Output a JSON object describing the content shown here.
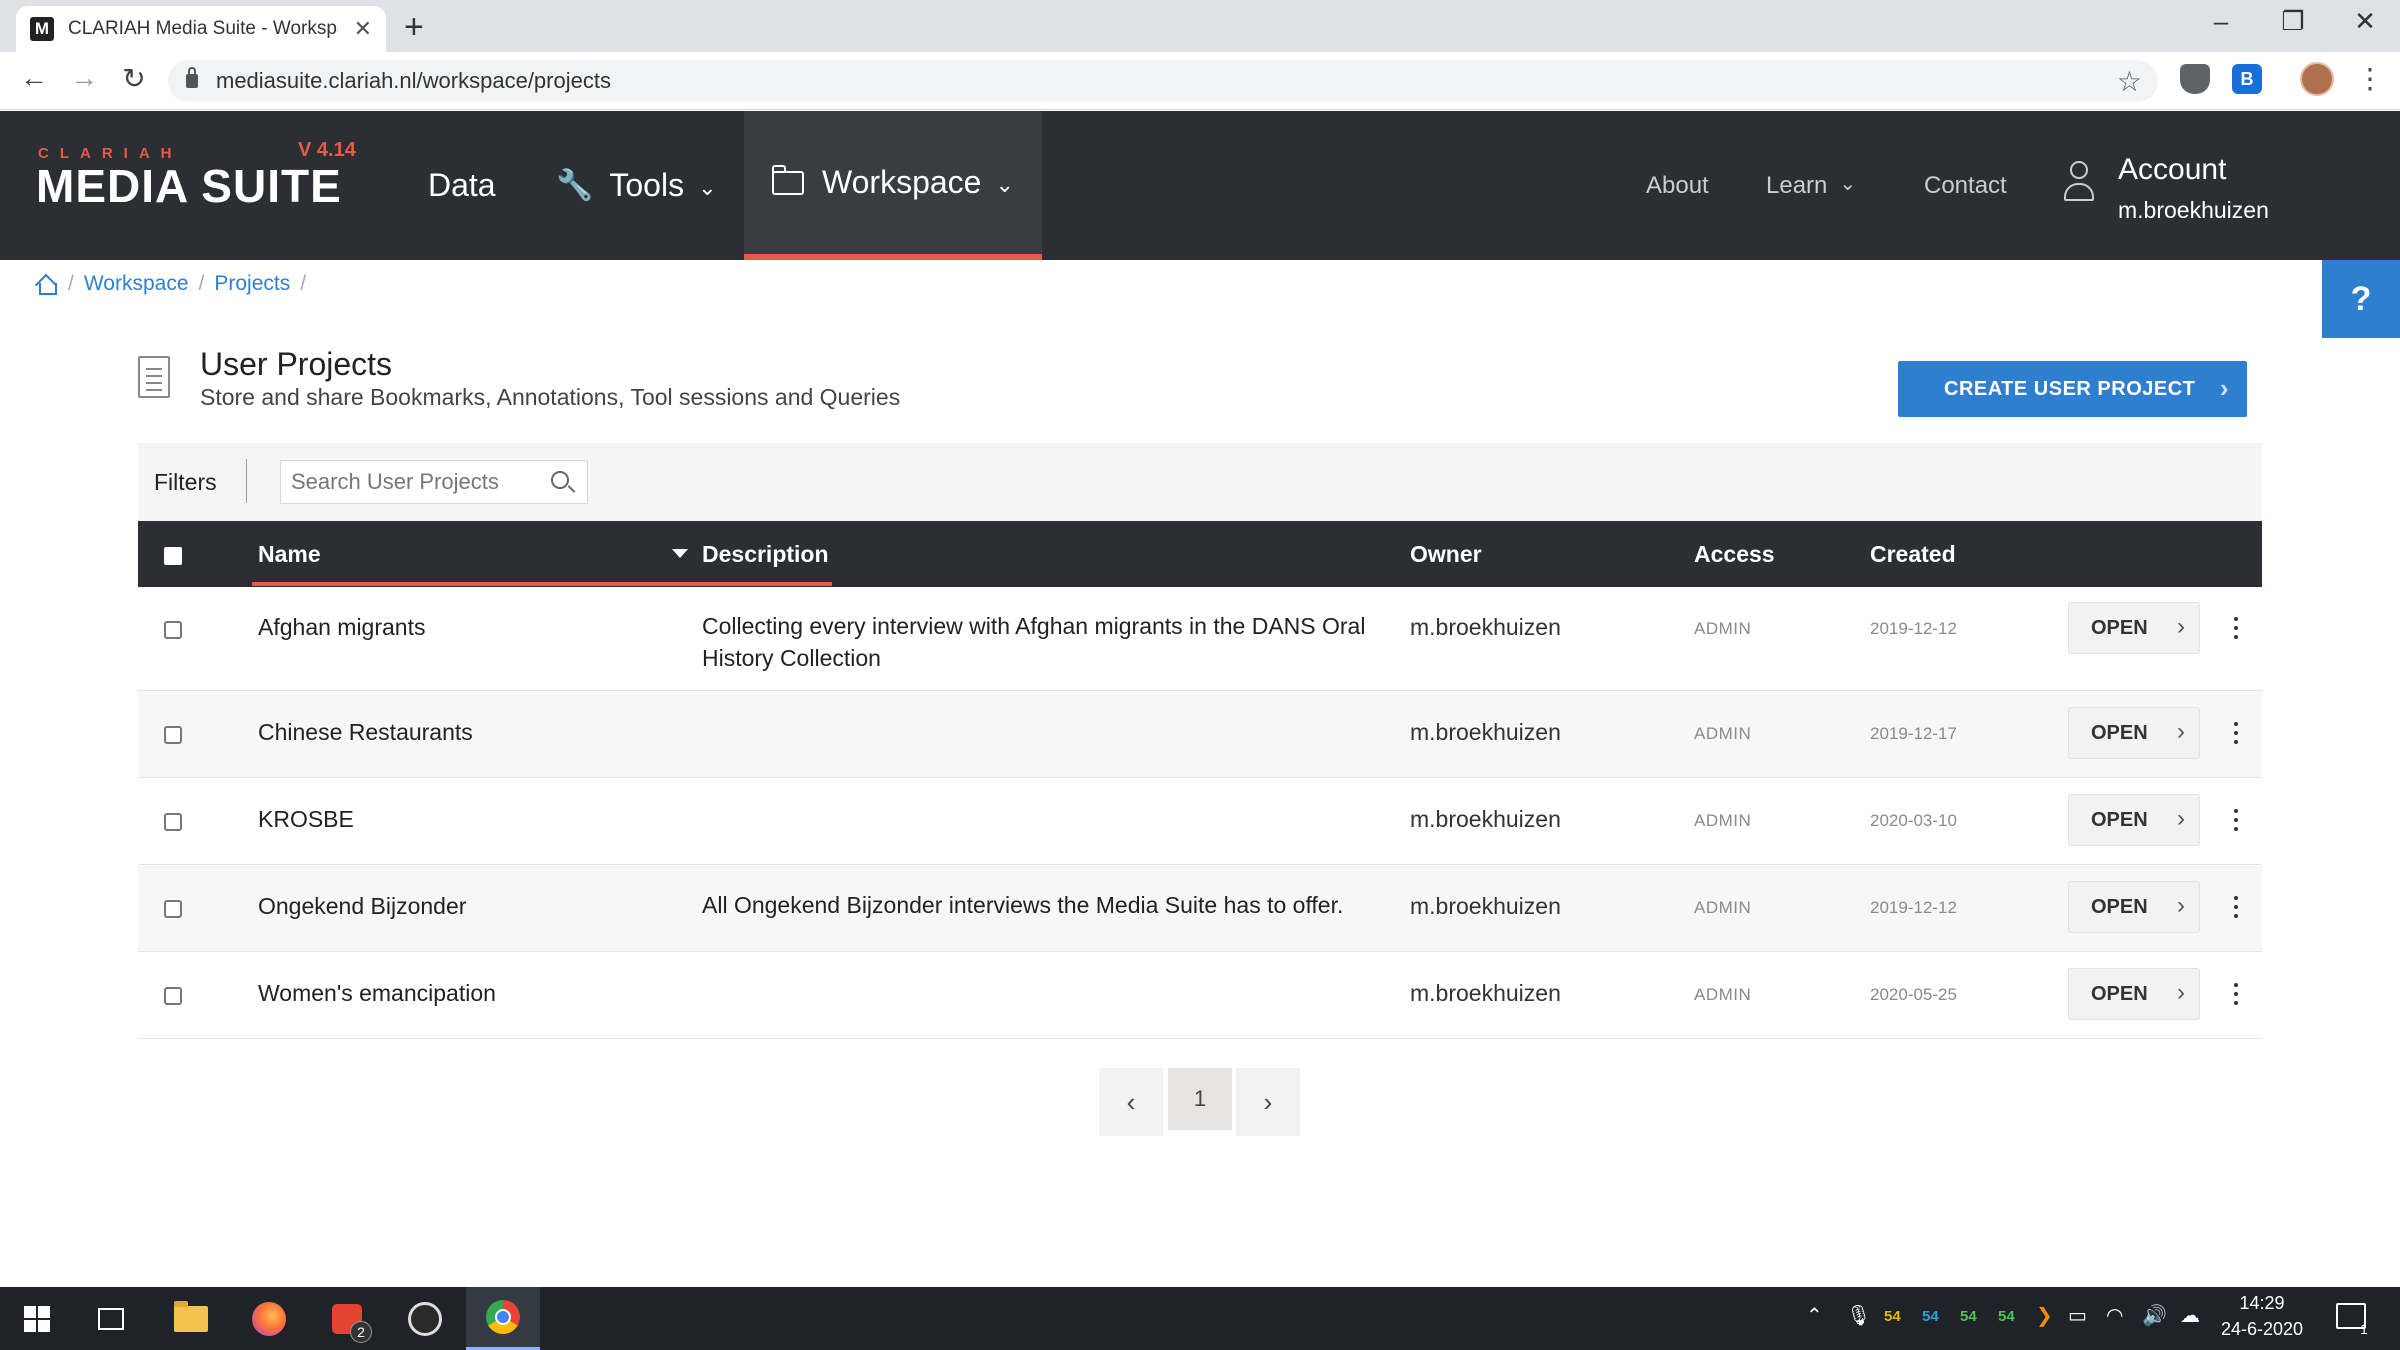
{
  "browser": {
    "tab_title": "CLARIAH Media Suite - Workspa",
    "favicon_letter": "M",
    "url": "mediasuite.clariah.nl/workspace/projects",
    "extension_letter": "B"
  },
  "header": {
    "logo_small": "CLARIAH",
    "logo_version": "V 4.14",
    "logo_main": "MEDIA SUITE",
    "nav": {
      "data": "Data",
      "tools": "Tools",
      "workspace": "Workspace",
      "about": "About",
      "learn": "Learn",
      "contact": "Contact"
    },
    "account_label": "Account",
    "account_user": "m.broekhuizen"
  },
  "help_label": "?",
  "breadcrumb": {
    "items": [
      "Workspace",
      "Projects"
    ]
  },
  "page": {
    "title": "User Projects",
    "subtitle": "Store and share Bookmarks, Annotations, Tool sessions and Queries",
    "create_button": "CREATE USER PROJECT"
  },
  "filters": {
    "label": "Filters",
    "search_placeholder": "Search User Projects"
  },
  "table": {
    "columns": {
      "name": "Name",
      "description": "Description",
      "owner": "Owner",
      "access": "Access",
      "created": "Created"
    },
    "open_label": "OPEN",
    "rows": [
      {
        "name": "Afghan migrants",
        "description": "Collecting every interview with Afghan migrants in the DANS Oral History Collection",
        "owner": "m.broekhuizen",
        "access": "ADMIN",
        "created": "2019-12-12"
      },
      {
        "name": "Chinese Restaurants",
        "description": "",
        "owner": "m.broekhuizen",
        "access": "ADMIN",
        "created": "2019-12-17"
      },
      {
        "name": "KROSBE",
        "description": "",
        "owner": "m.broekhuizen",
        "access": "ADMIN",
        "created": "2020-03-10"
      },
      {
        "name": "Ongekend Bijzonder",
        "description": "All Ongekend Bijzonder interviews the Media Suite has to offer.",
        "owner": "m.broekhuizen",
        "access": "ADMIN",
        "created": "2019-12-12"
      },
      {
        "name": "Women's emancipation",
        "description": "",
        "owner": "m.broekhuizen",
        "access": "ADMIN",
        "created": "2020-05-25"
      }
    ]
  },
  "pagination": {
    "current_page": "1"
  },
  "taskbar": {
    "todoist_badge": "2",
    "tray_numbers": [
      "54",
      "54",
      "54",
      "54"
    ],
    "time": "14:29",
    "date": "24-6-2020",
    "notification_count": "1"
  },
  "colors": {
    "accent": "#e85a45",
    "primary_blue": "#2f7fd1",
    "header_bg": "#2b2f33"
  }
}
